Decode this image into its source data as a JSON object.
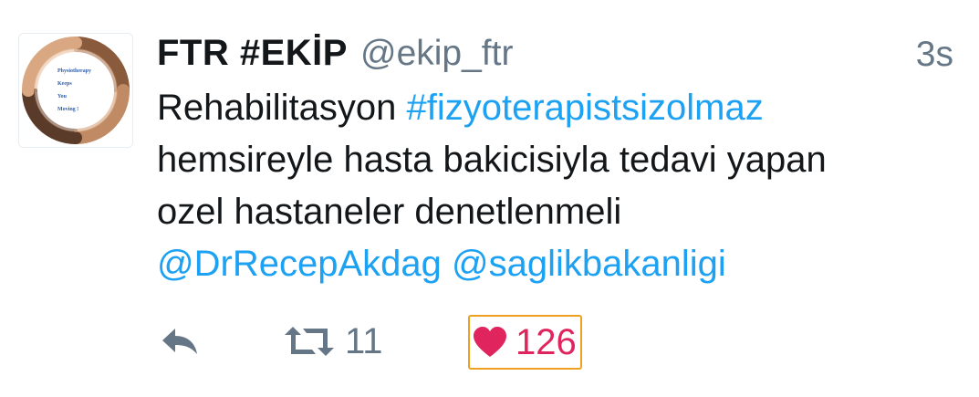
{
  "tweet": {
    "display_name": "FTR #EKİP",
    "handle": "@ekip_ftr",
    "timestamp": "3s",
    "avatar": {
      "lines": [
        "Physiotherapy",
        "Keeps",
        "You",
        "Moving !"
      ]
    },
    "text": {
      "line1_plain": "Rehabilitasyon ",
      "line1_hashtag": "#fizyoterapistsizolmaz",
      "line2": "hemsireyle hasta bakicisiyla tedavi yapan",
      "line3": "ozel hastaneler denetlenmeli",
      "mention1": "@DrRecepAkdag",
      "mention2": "@saglikbakanligi"
    },
    "actions": {
      "reply_icon": "reply-icon",
      "retweet_icon": "retweet-icon",
      "retweet_count": "11",
      "like_icon": "heart-icon",
      "like_count": "126"
    },
    "colors": {
      "link": "#1da1f2",
      "like": "#e0245e",
      "muted": "#657786",
      "highlight_box": "#f0a020"
    }
  }
}
